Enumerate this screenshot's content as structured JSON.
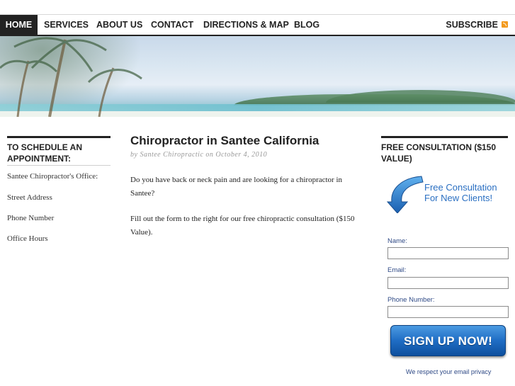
{
  "nav": {
    "items": [
      {
        "label": "HOME"
      },
      {
        "label": "SERVICES"
      },
      {
        "label": "ABOUT US"
      },
      {
        "label": "CONTACT"
      },
      {
        "label": "DIRECTIONS & MAP"
      },
      {
        "label": "BLOG"
      }
    ],
    "active_index": 0,
    "subscribe_label": "SUBSCRIBE"
  },
  "left_sidebar": {
    "title": "TO SCHEDULE AN APPOINTMENT:",
    "items": [
      "Santee Chiropractor's Office:",
      "Street Address",
      "Phone Number",
      "Office Hours"
    ]
  },
  "post": {
    "title": "Chiropractor in Santee California",
    "meta": "by Santee Chiropractic on October 4, 2010",
    "paragraphs": [
      "Do you have back or neck pain and are looking for a chiropractor in Santee?",
      "Fill out the form to the right for our free chiropractic consultation ($150 Value)."
    ]
  },
  "right_sidebar": {
    "title": "FREE CONSULTATION ($150 VALUE)",
    "banner_line1": "Free Consultation",
    "banner_line2": "For New Clients!",
    "form": {
      "name_label": "Name:",
      "email_label": "Email:",
      "phone_label": "Phone Number:",
      "name_value": "",
      "email_value": "",
      "phone_value": ""
    },
    "signup_label": "SIGN UP NOW!",
    "privacy_text": "We respect your email privacy"
  },
  "colors": {
    "nav_active_bg": "#222222",
    "link_blue": "#2a6fc2",
    "signup_blue": "#1f6dc4",
    "rss_orange": "#f39a1d"
  }
}
